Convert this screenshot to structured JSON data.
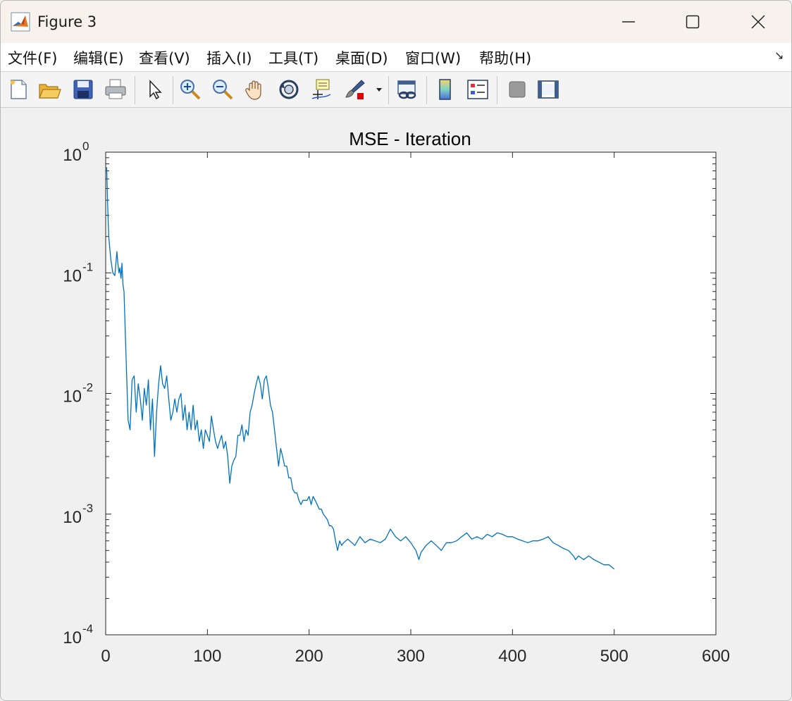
{
  "window": {
    "title": "Figure 3",
    "icon": "matlab-logo-icon",
    "controls": [
      "minimize-icon",
      "maximize-icon",
      "close-icon"
    ]
  },
  "menu": {
    "items": [
      "文件(F)",
      "编辑(E)",
      "查看(V)",
      "插入(I)",
      "工具(T)",
      "桌面(D)",
      "窗口(W)",
      "帮助(H)"
    ],
    "overflow_icon": "dock-arrow-icon"
  },
  "toolbar": {
    "icons": [
      "new-figure-icon",
      "open-file-icon",
      "save-icon",
      "print-icon",
      "pointer-icon",
      "zoom-in-icon",
      "zoom-out-icon",
      "pan-hand-icon",
      "rotate-3d-icon",
      "data-cursor-icon",
      "brush-icon",
      "brush-dropdown-icon",
      "link-plot-icon",
      "colorbar-icon",
      "legend-icon",
      "hide-plot-tools-icon",
      "show-plot-tools-icon"
    ]
  },
  "colors": {
    "line": "#0072bd",
    "axes": "#262626",
    "plot_bg": "#ffffff",
    "figure_bg": "#f0f0f0"
  },
  "chart_data": {
    "type": "line",
    "title": "MSE - Iteration",
    "xlabel": "",
    "ylabel": "",
    "xlim": [
      0,
      600
    ],
    "ylim": [
      0.0001,
      1
    ],
    "yscale": "log",
    "grid": false,
    "xticks": [
      "0",
      "100",
      "200",
      "300",
      "400",
      "500",
      "600"
    ],
    "yticks": [
      {
        "base": "10",
        "exp": "-4"
      },
      {
        "base": "10",
        "exp": "-3"
      },
      {
        "base": "10",
        "exp": "-2"
      },
      {
        "base": "10",
        "exp": "-1"
      },
      {
        "base": "10",
        "exp": "0"
      }
    ],
    "series": [
      {
        "color": "#0072bd",
        "x": [
          1,
          2,
          3,
          5,
          7,
          9,
          11,
          12,
          13,
          14,
          15,
          16,
          17,
          18,
          20,
          22,
          24,
          26,
          28,
          30,
          32,
          34,
          36,
          38,
          40,
          42,
          44,
          46,
          48,
          50,
          52,
          54,
          56,
          58,
          60,
          62,
          64,
          66,
          68,
          70,
          72,
          74,
          76,
          78,
          80,
          82,
          84,
          86,
          88,
          90,
          92,
          94,
          96,
          98,
          100,
          102,
          104,
          106,
          108,
          110,
          112,
          114,
          116,
          118,
          120,
          122,
          124,
          126,
          128,
          130,
          132,
          134,
          136,
          138,
          140,
          142,
          144,
          146,
          148,
          150,
          152,
          154,
          156,
          158,
          160,
          162,
          164,
          166,
          168,
          170,
          172,
          174,
          176,
          178,
          180,
          182,
          184,
          186,
          188,
          190,
          192,
          194,
          196,
          198,
          200,
          202,
          204,
          206,
          208,
          210,
          212,
          214,
          216,
          218,
          220,
          222,
          224,
          226,
          228,
          230,
          232,
          234,
          236,
          238,
          240,
          245,
          250,
          255,
          260,
          265,
          270,
          275,
          280,
          285,
          290,
          295,
          300,
          305,
          308,
          310,
          315,
          320,
          325,
          330,
          335,
          340,
          345,
          350,
          355,
          360,
          365,
          370,
          375,
          380,
          385,
          390,
          395,
          400,
          405,
          410,
          415,
          420,
          425,
          430,
          435,
          440,
          445,
          450,
          455,
          460,
          462,
          465,
          470,
          475,
          480,
          485,
          490,
          495,
          500
        ],
        "y": [
          0.75,
          0.35,
          0.2,
          0.13,
          0.1,
          0.095,
          0.15,
          0.12,
          0.1,
          0.11,
          0.09,
          0.12,
          0.08,
          0.07,
          0.02,
          0.006,
          0.005,
          0.013,
          0.014,
          0.007,
          0.012,
          0.009,
          0.006,
          0.011,
          0.008,
          0.013,
          0.005,
          0.009,
          0.003,
          0.007,
          0.012,
          0.017,
          0.012,
          0.011,
          0.014,
          0.009,
          0.006,
          0.007,
          0.009,
          0.007,
          0.009,
          0.01,
          0.006,
          0.008,
          0.005,
          0.007,
          0.005,
          0.008,
          0.005,
          0.006,
          0.004,
          0.005,
          0.0035,
          0.005,
          0.0045,
          0.004,
          0.0065,
          0.005,
          0.004,
          0.0035,
          0.004,
          0.0045,
          0.0035,
          0.004,
          0.003,
          0.0018,
          0.0025,
          0.0028,
          0.003,
          0.0045,
          0.0045,
          0.0055,
          0.004,
          0.005,
          0.0045,
          0.007,
          0.008,
          0.01,
          0.012,
          0.014,
          0.012,
          0.009,
          0.013,
          0.014,
          0.011,
          0.008,
          0.007,
          0.005,
          0.0035,
          0.0025,
          0.0035,
          0.003,
          0.0025,
          0.0025,
          0.002,
          0.002,
          0.0016,
          0.0015,
          0.0015,
          0.0013,
          0.0012,
          0.0013,
          0.0013,
          0.0013,
          0.0014,
          0.0012,
          0.0014,
          0.0013,
          0.0012,
          0.0011,
          0.0011,
          0.001,
          0.00095,
          0.0009,
          0.0008,
          0.0008,
          0.00075,
          0.0006,
          0.0005,
          0.0006,
          0.00055,
          0.00058,
          0.0006,
          0.00062,
          0.0006,
          0.00055,
          0.00065,
          0.00058,
          0.00062,
          0.0006,
          0.00058,
          0.00062,
          0.00075,
          0.00065,
          0.0006,
          0.00065,
          0.00058,
          0.0005,
          0.00042,
          0.00048,
          0.00055,
          0.0006,
          0.00055,
          0.0005,
          0.00058,
          0.00058,
          0.0006,
          0.00065,
          0.0007,
          0.00062,
          0.00065,
          0.00062,
          0.00068,
          0.00065,
          0.0007,
          0.00068,
          0.00065,
          0.00065,
          0.00062,
          0.0006,
          0.00058,
          0.0006,
          0.0006,
          0.00062,
          0.00065,
          0.00058,
          0.00055,
          0.00052,
          0.0005,
          0.00045,
          0.00042,
          0.00045,
          0.00042,
          0.00045,
          0.00042,
          0.0004,
          0.00038,
          0.00038,
          0.00035
        ]
      }
    ]
  }
}
